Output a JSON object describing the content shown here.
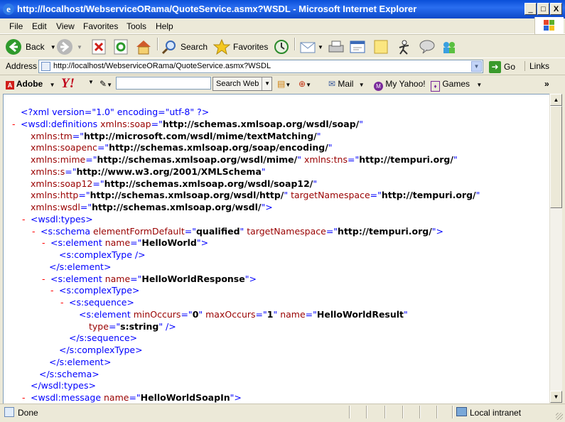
{
  "window": {
    "title": "http://localhost/WebserviceORama/QuoteService.asmx?WSDL - Microsoft Internet Explorer",
    "minimize": "_",
    "maximize": "□",
    "close": "X"
  },
  "menu": [
    "File",
    "Edit",
    "View",
    "Favorites",
    "Tools",
    "Help"
  ],
  "toolbar": {
    "back": "Back",
    "search": "Search",
    "favorites": "Favorites"
  },
  "address": {
    "label": "Address",
    "value": "http://localhost/WebserviceORama/QuoteService.asmx?WSDL",
    "go": "Go",
    "links": "Links"
  },
  "yahoo_bar": {
    "adobe": "Adobe",
    "logo": "Y!",
    "search_button": "Search Web",
    "mail": "Mail",
    "my_yahoo": "My Yahoo!",
    "games": "Games"
  },
  "xml_lines": [
    {
      "m": "",
      "parts": [
        {
          "c": "b",
          "t": "<?xml version=\"1.0\" encoding=\"utf-8\" ?>"
        }
      ]
    },
    {
      "m": "-",
      "parts": [
        {
          "c": "b",
          "t": "<wsdl:definitions "
        },
        {
          "c": "r",
          "t": "xmlns:soap"
        },
        {
          "c": "b",
          "t": "=\""
        },
        {
          "c": "k",
          "t": "http://schemas.xmlsoap.org/wsdl/soap/"
        },
        {
          "c": "b",
          "t": "\""
        }
      ]
    },
    {
      "m": "",
      "parts": [
        {
          "c": "r",
          "t": "xmlns:tm"
        },
        {
          "c": "b",
          "t": "=\""
        },
        {
          "c": "k",
          "t": "http://microsoft.com/wsdl/mime/textMatching/"
        },
        {
          "c": "b",
          "t": "\""
        }
      ]
    },
    {
      "m": "",
      "parts": [
        {
          "c": "r",
          "t": "xmlns:soapenc"
        },
        {
          "c": "b",
          "t": "=\""
        },
        {
          "c": "k",
          "t": "http://schemas.xmlsoap.org/soap/encoding/"
        },
        {
          "c": "b",
          "t": "\""
        }
      ]
    },
    {
      "m": "",
      "parts": [
        {
          "c": "r",
          "t": "xmlns:mime"
        },
        {
          "c": "b",
          "t": "=\""
        },
        {
          "c": "k",
          "t": "http://schemas.xmlsoap.org/wsdl/mime/"
        },
        {
          "c": "b",
          "t": "\" "
        },
        {
          "c": "r",
          "t": "xmlns:tns"
        },
        {
          "c": "b",
          "t": "=\""
        },
        {
          "c": "k",
          "t": "http://tempuri.org/"
        },
        {
          "c": "b",
          "t": "\""
        }
      ]
    },
    {
      "m": "",
      "parts": [
        {
          "c": "r",
          "t": "xmlns:s"
        },
        {
          "c": "b",
          "t": "=\""
        },
        {
          "c": "k",
          "t": "http://www.w3.org/2001/XMLSchema"
        },
        {
          "c": "b",
          "t": "\""
        }
      ]
    },
    {
      "m": "",
      "parts": [
        {
          "c": "r",
          "t": "xmlns:soap12"
        },
        {
          "c": "b",
          "t": "=\""
        },
        {
          "c": "k",
          "t": "http://schemas.xmlsoap.org/wsdl/soap12/"
        },
        {
          "c": "b",
          "t": "\""
        }
      ]
    },
    {
      "m": "",
      "parts": [
        {
          "c": "r",
          "t": "xmlns:http"
        },
        {
          "c": "b",
          "t": "=\""
        },
        {
          "c": "k",
          "t": "http://schemas.xmlsoap.org/wsdl/http/"
        },
        {
          "c": "b",
          "t": "\" "
        },
        {
          "c": "r",
          "t": "targetNamespace"
        },
        {
          "c": "b",
          "t": "=\""
        },
        {
          "c": "k",
          "t": "http://tempuri.org/"
        },
        {
          "c": "b",
          "t": "\""
        }
      ]
    },
    {
      "m": "",
      "parts": [
        {
          "c": "r",
          "t": "xmlns:wsdl"
        },
        {
          "c": "b",
          "t": "=\""
        },
        {
          "c": "k",
          "t": "http://schemas.xmlsoap.org/wsdl/"
        },
        {
          "c": "b",
          "t": "\">"
        }
      ]
    },
    {
      "m": "-",
      "parts": [
        {
          "c": "b",
          "t": "<wsdl:types>"
        }
      ]
    },
    {
      "m": "-",
      "parts": [
        {
          "c": "b",
          "t": "<s:schema "
        },
        {
          "c": "r",
          "t": "elementFormDefault"
        },
        {
          "c": "b",
          "t": "=\""
        },
        {
          "c": "k",
          "t": "qualified"
        },
        {
          "c": "b",
          "t": "\" "
        },
        {
          "c": "r",
          "t": "targetNamespace"
        },
        {
          "c": "b",
          "t": "=\""
        },
        {
          "c": "k",
          "t": "http://tempuri.org/"
        },
        {
          "c": "b",
          "t": "\">"
        }
      ]
    },
    {
      "m": "-",
      "parts": [
        {
          "c": "b",
          "t": "<s:element "
        },
        {
          "c": "r",
          "t": "name"
        },
        {
          "c": "b",
          "t": "=\""
        },
        {
          "c": "k",
          "t": "HelloWorld"
        },
        {
          "c": "b",
          "t": "\">"
        }
      ]
    },
    {
      "m": "",
      "parts": [
        {
          "c": "b",
          "t": "<s:complexType />"
        }
      ]
    },
    {
      "m": "",
      "parts": [
        {
          "c": "b",
          "t": "</s:element>"
        }
      ]
    },
    {
      "m": "-",
      "parts": [
        {
          "c": "b",
          "t": "<s:element "
        },
        {
          "c": "r",
          "t": "name"
        },
        {
          "c": "b",
          "t": "=\""
        },
        {
          "c": "k",
          "t": "HelloWorldResponse"
        },
        {
          "c": "b",
          "t": "\">"
        }
      ]
    },
    {
      "m": "-",
      "parts": [
        {
          "c": "b",
          "t": "<s:complexType>"
        }
      ]
    },
    {
      "m": "-",
      "parts": [
        {
          "c": "b",
          "t": "<s:sequence>"
        }
      ]
    },
    {
      "m": "",
      "parts": [
        {
          "c": "b",
          "t": "<s:element "
        },
        {
          "c": "r",
          "t": "minOccurs"
        },
        {
          "c": "b",
          "t": "=\""
        },
        {
          "c": "k",
          "t": "0"
        },
        {
          "c": "b",
          "t": "\" "
        },
        {
          "c": "r",
          "t": "maxOccurs"
        },
        {
          "c": "b",
          "t": "=\""
        },
        {
          "c": "k",
          "t": "1"
        },
        {
          "c": "b",
          "t": "\" "
        },
        {
          "c": "r",
          "t": "name"
        },
        {
          "c": "b",
          "t": "=\""
        },
        {
          "c": "k",
          "t": "HelloWorldResult"
        },
        {
          "c": "b",
          "t": "\""
        }
      ]
    },
    {
      "m": "",
      "parts": [
        {
          "c": "r",
          "t": "type"
        },
        {
          "c": "b",
          "t": "=\""
        },
        {
          "c": "k",
          "t": "s:string"
        },
        {
          "c": "b",
          "t": "\" />"
        }
      ]
    },
    {
      "m": "",
      "parts": [
        {
          "c": "b",
          "t": "</s:sequence>"
        }
      ]
    },
    {
      "m": "",
      "parts": [
        {
          "c": "b",
          "t": "</s:complexType>"
        }
      ]
    },
    {
      "m": "",
      "parts": [
        {
          "c": "b",
          "t": "</s:element>"
        }
      ]
    },
    {
      "m": "",
      "parts": [
        {
          "c": "b",
          "t": "</s:schema>"
        }
      ]
    },
    {
      "m": "",
      "parts": [
        {
          "c": "b",
          "t": "</wsdl:types>"
        }
      ]
    },
    {
      "m": "-",
      "parts": [
        {
          "c": "b",
          "t": "<wsdl:message "
        },
        {
          "c": "r",
          "t": "name"
        },
        {
          "c": "b",
          "t": "=\""
        },
        {
          "c": "k",
          "t": "HelloWorldSoapIn"
        },
        {
          "c": "b",
          "t": "\">"
        }
      ]
    }
  ],
  "status": {
    "text": "Done",
    "zone": "Local intranet"
  }
}
